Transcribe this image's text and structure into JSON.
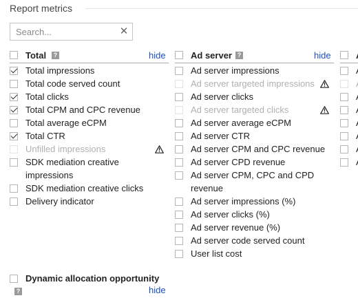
{
  "section": {
    "title": "Report metrics"
  },
  "search": {
    "placeholder": "Search...",
    "value": "",
    "clear_glyph": "✕"
  },
  "help_glyph": "?",
  "columns": [
    {
      "header": "Total",
      "hide_label": "hide",
      "items": [
        {
          "label": "Total impressions",
          "checked": true,
          "disabled": false
        },
        {
          "label": "Total code served count",
          "checked": false,
          "disabled": false
        },
        {
          "label": "Total clicks",
          "checked": true,
          "disabled": false
        },
        {
          "label": "Total CPM and CPC revenue",
          "checked": true,
          "disabled": false
        },
        {
          "label": "Total average eCPM",
          "checked": false,
          "disabled": false
        },
        {
          "label": "Total CTR",
          "checked": true,
          "disabled": false
        },
        {
          "label": "Unfilled impressions",
          "checked": false,
          "disabled": true,
          "warning": true
        },
        {
          "label_lines": [
            "SDK mediation creative",
            "impressions"
          ],
          "checked": false,
          "disabled": false
        },
        {
          "label": "SDK mediation creative clicks",
          "checked": false,
          "disabled": false
        },
        {
          "label": "Delivery indicator",
          "checked": false,
          "disabled": false
        }
      ]
    },
    {
      "header": "Ad server",
      "hide_label": "hide",
      "items": [
        {
          "label": "Ad server impressions",
          "checked": false,
          "disabled": false
        },
        {
          "label": "Ad server targeted impressions",
          "checked": false,
          "disabled": true,
          "warning": true
        },
        {
          "label": "Ad server clicks",
          "checked": false,
          "disabled": false
        },
        {
          "label": "Ad server targeted clicks",
          "checked": false,
          "disabled": true,
          "warning": true
        },
        {
          "label": "Ad server average eCPM",
          "checked": false,
          "disabled": false
        },
        {
          "label": "Ad server CTR",
          "checked": false,
          "disabled": false
        },
        {
          "label": "Ad server CPM and CPC revenue",
          "checked": false,
          "disabled": false
        },
        {
          "label": "Ad server CPD revenue",
          "checked": false,
          "disabled": false
        },
        {
          "label_lines": [
            "Ad server CPM, CPC and CPD",
            "revenue"
          ],
          "checked": false,
          "disabled": false
        },
        {
          "label": "Ad server impressions (%)",
          "checked": false,
          "disabled": false
        },
        {
          "label": "Ad server clicks (%)",
          "checked": false,
          "disabled": false
        },
        {
          "label": "Ad server revenue (%)",
          "checked": false,
          "disabled": false
        },
        {
          "label": "Ad server code served count",
          "checked": false,
          "disabled": false
        },
        {
          "label": "User list cost",
          "checked": false,
          "disabled": false
        }
      ]
    },
    {
      "header": "A",
      "items": [
        {
          "label": "A",
          "disabled": false
        },
        {
          "label": "A",
          "disabled": true
        },
        {
          "label": "A",
          "disabled": false
        },
        {
          "label": "A",
          "disabled": false
        },
        {
          "label": "A",
          "disabled": false
        },
        {
          "label": "A",
          "disabled": false
        },
        {
          "label": "A",
          "disabled": false
        },
        {
          "label": "A",
          "disabled": false
        }
      ]
    }
  ],
  "dynamic_allocation": {
    "header": "Dynamic allocation opportunity",
    "hide_label": "hide"
  },
  "colors": {
    "link": "#1a4fc4",
    "disabled_text": "#b0b0b0",
    "checkbox_border": "#b5b5b5"
  }
}
